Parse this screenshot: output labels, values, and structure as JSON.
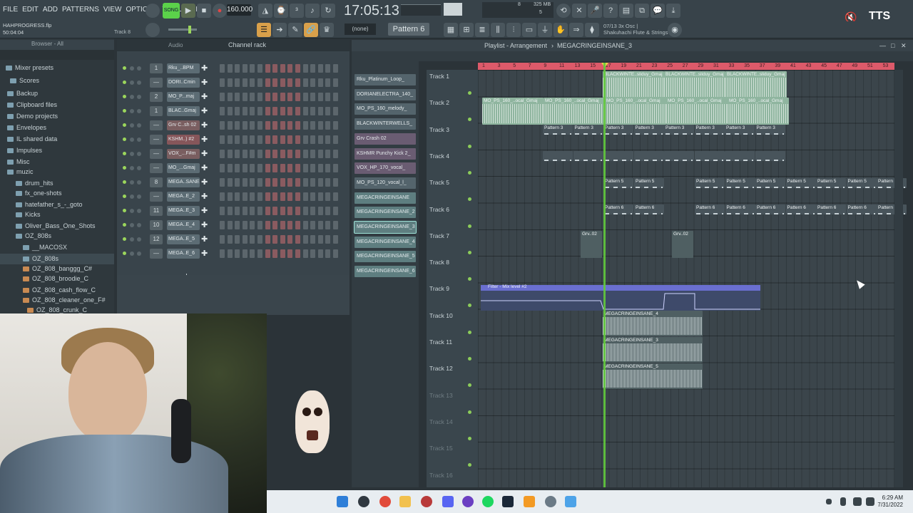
{
  "menu": [
    "FILE",
    "EDIT",
    "ADD",
    "PATTERNS",
    "VIEW",
    "OPTIONS",
    "TOOLS",
    "HELP"
  ],
  "transport": {
    "song_label": "SONG",
    "bpm": "160.000",
    "clock": "17:05:13",
    "memory": "325 MB",
    "cpu_top": "8",
    "cpu_bottom": "5"
  },
  "project": {
    "file": "HAHPROGRESS.flp",
    "time": "50:04:04",
    "track": "Track 8"
  },
  "pattern_selector": "Pattern 6",
  "snap": "(none)",
  "hint": {
    "line1": "07/13  3x Osc |",
    "line2": "Shakuhachi Flute & Strings"
  },
  "tts": "TTS",
  "browser": {
    "header": "Browser - All",
    "items": [
      {
        "label": "Mixer presets",
        "sub": false
      },
      {
        "label": "Scores",
        "sub": false
      },
      {
        "label": "Backup",
        "sub": false
      },
      {
        "label": "Clipboard files",
        "sub": false
      },
      {
        "label": "Demo projects",
        "sub": false
      },
      {
        "label": "Envelopes",
        "sub": false
      },
      {
        "label": "IL shared data",
        "sub": false
      },
      {
        "label": "Impulses",
        "sub": false
      },
      {
        "label": "Misc",
        "sub": false
      },
      {
        "label": "muzic",
        "sub": false
      },
      {
        "label": "drum_hits",
        "sub": false
      },
      {
        "label": "fx_one-shots",
        "sub": false
      },
      {
        "label": "hatefather_s_-_goto",
        "sub": false
      },
      {
        "label": "Kicks",
        "sub": false
      },
      {
        "label": "Oliver_Bass_One_Shots",
        "sub": false
      },
      {
        "label": "OZ_808s",
        "sub": false
      },
      {
        "label": "__MACOSX",
        "sub": false
      },
      {
        "label": "OZ_808s",
        "sub": false
      },
      {
        "label": "OZ_808_banggg_C#",
        "sub": true
      },
      {
        "label": "OZ_808_broodie_C",
        "sub": true
      },
      {
        "label": "OZ_808_cash_flow_C",
        "sub": true
      },
      {
        "label": "OZ_808_cleaner_one_F#",
        "sub": true
      },
      {
        "label": "OZ_808_crunk_C",
        "sub": true
      }
    ]
  },
  "channel_rack": {
    "title": "Channel rack",
    "swing_label": "Audio",
    "rows": [
      {
        "num": "1",
        "name": "Rku_..BPM",
        "color": "normal"
      },
      {
        "num": "—",
        "name": "DORI..Cmin",
        "color": "normal"
      },
      {
        "num": "2",
        "name": "MO_P...maj",
        "color": "normal"
      },
      {
        "num": "1",
        "name": "BLAC..Gmaj",
        "color": "normal"
      },
      {
        "num": "—",
        "name": "Grv C..sh 02",
        "color": "red"
      },
      {
        "num": "—",
        "name": "KSHM..) #2",
        "color": "red2"
      },
      {
        "num": "—",
        "name": "VOX_...F#m",
        "color": "red"
      },
      {
        "num": "—",
        "name": "MO_...Gmaj",
        "color": "normal"
      },
      {
        "num": "8",
        "name": "MEGA..SANE",
        "color": "normal"
      },
      {
        "num": "—",
        "name": "MEGA..E_2",
        "color": "normal"
      },
      {
        "num": "11",
        "name": "MEGA..E_3",
        "color": "normal"
      },
      {
        "num": "10",
        "name": "MEGA..E_4",
        "color": "normal"
      },
      {
        "num": "12",
        "name": "MEGA..E_5",
        "color": "normal"
      },
      {
        "num": "—",
        "name": "MEGA..E_6",
        "color": "normal"
      }
    ]
  },
  "picker": [
    {
      "label": "Rku_Platinum_Loop_",
      "color": "normal"
    },
    {
      "label": "DORIANELECTRA_140_",
      "color": "normal"
    },
    {
      "label": "MO_PS_160_melody_",
      "color": "normal"
    },
    {
      "label": "BLACKWINTERWELLS_",
      "color": "normal"
    },
    {
      "label": "Grv Crash 02",
      "color": "purple"
    },
    {
      "label": "KSHMR Punchy Kick 2_",
      "color": "purple"
    },
    {
      "label": "VOX_HP_170_vocal_",
      "color": "purple"
    },
    {
      "label": "MO_PS_120_vocal_l_",
      "color": "normal"
    },
    {
      "label": "MEGACRINGEINSANE",
      "color": "teal"
    },
    {
      "label": "MEGACRINGEINSANE_2",
      "color": "teal"
    },
    {
      "label": "MEGACRINGEINSANE_3",
      "color": "teal"
    },
    {
      "label": "MEGACRINGEINSANE_4",
      "color": "teal"
    },
    {
      "label": "MEGACRINGEINSANE_5",
      "color": "teal"
    },
    {
      "label": "MEGACRINGEINSANE_6",
      "color": "teal"
    }
  ],
  "playlist": {
    "title": "Playlist - Arrangement",
    "breadcrumb": "MEGACRINGEINSANE_3",
    "ruler": [
      "1",
      "3",
      "5",
      "7",
      "9",
      "11",
      "13",
      "15",
      "17",
      "19",
      "21",
      "23",
      "25",
      "27",
      "29",
      "31",
      "33",
      "35",
      "37",
      "39",
      "41",
      "43",
      "45",
      "47",
      "49",
      "51",
      "53"
    ],
    "tracks": [
      "Track 1",
      "Track 2",
      "Track 3",
      "Track 4",
      "Track 5",
      "Track 6",
      "Track 7",
      "Track 8",
      "Track 9",
      "Track 10",
      "Track 11",
      "Track 12",
      "Track 13",
      "Track 14",
      "Track 15",
      "Track 16"
    ],
    "clips": {
      "t1": "BLACKWINTE..sliduy_Gmaj",
      "t2": "MO_PS_160_..ocal_Gmaj",
      "t3": "Pattern 3",
      "t5": "Pattern 5",
      "t6": "Pattern 6",
      "t7": "Grv..02",
      "t9": "Filter - Mix level #2",
      "t10": "MEGACRINGEINSANE_4",
      "t11": "MEGACRINGEINSANE_3",
      "t12": "MEGACRINGEINSANE_5"
    }
  },
  "taskbar": {
    "time": "6:29 AM",
    "date": "7/31/2022"
  }
}
